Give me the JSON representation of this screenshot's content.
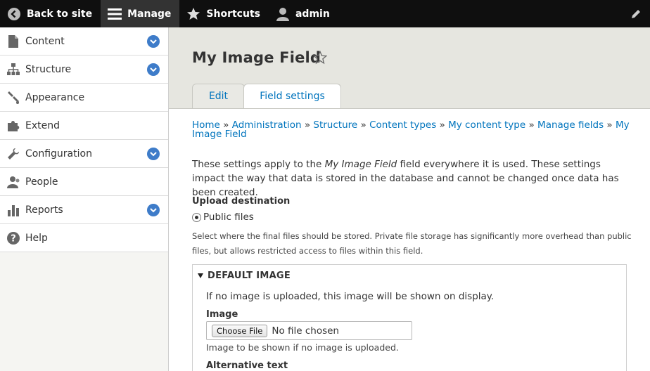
{
  "toolbar": {
    "back_label": "Back to site",
    "manage_label": "Manage",
    "shortcuts_label": "Shortcuts",
    "user_label": "admin"
  },
  "sidebar": {
    "items": [
      {
        "label": "Content",
        "icon": "document-icon",
        "expandable": true
      },
      {
        "label": "Structure",
        "icon": "sitemap-icon",
        "expandable": true
      },
      {
        "label": "Appearance",
        "icon": "paintbrush-icon",
        "expandable": false
      },
      {
        "label": "Extend",
        "icon": "puzzle-icon",
        "expandable": false
      },
      {
        "label": "Configuration",
        "icon": "wrench-icon",
        "expandable": true
      },
      {
        "label": "People",
        "icon": "people-icon",
        "expandable": false
      },
      {
        "label": "Reports",
        "icon": "bar-chart-icon",
        "expandable": true
      },
      {
        "label": "Help",
        "icon": "help-icon",
        "expandable": false
      }
    ]
  },
  "page": {
    "title": "My Image Field",
    "tabs": [
      {
        "label": "Edit",
        "active": false
      },
      {
        "label": "Field settings",
        "active": true
      }
    ]
  },
  "breadcrumb": [
    "Home",
    "Administration",
    "Structure",
    "Content types",
    "My content type",
    "Manage fields",
    "My Image Field"
  ],
  "description": {
    "prefix": "These settings apply to the ",
    "field_name": "My Image Field",
    "suffix": " field everywhere it is used. These settings impact the way that data is stored in the database and cannot be changed once data has been created."
  },
  "upload": {
    "label": "Upload destination",
    "option_label": "Public files",
    "help": "Select where the final files should be stored. Private file storage has significantly more overhead than public files, but allows restricted access to files within this field."
  },
  "default_image": {
    "legend": "DEFAULT IMAGE",
    "description": "If no image is uploaded, this image will be shown on display.",
    "image_label": "Image",
    "choose_button": "Choose File",
    "no_file": "No file chosen",
    "hint": "Image to be shown if no image is uploaded.",
    "alt_label": "Alternative text"
  },
  "colors": {
    "link": "#0074bd",
    "toolbar_bg": "#0f0f0f",
    "accent_blue": "#3e7cc9"
  }
}
